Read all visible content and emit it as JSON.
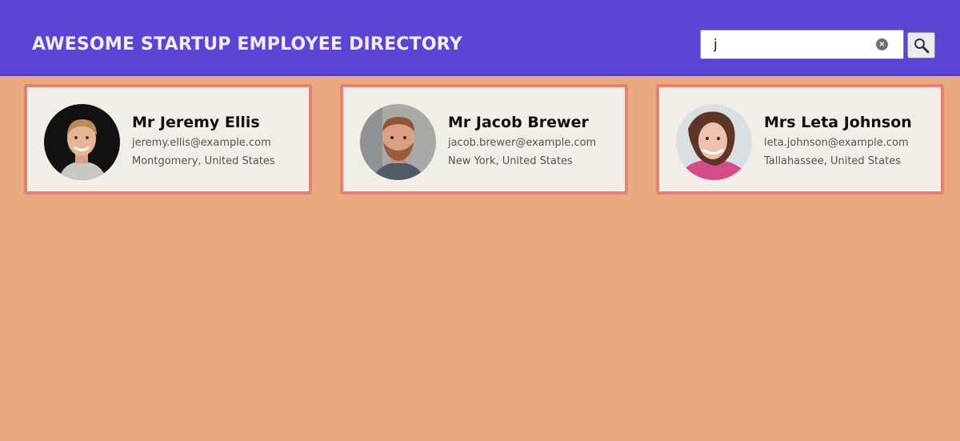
{
  "header": {
    "title": "AWESOME STARTUP EMPLOYEE DIRECTORY"
  },
  "search": {
    "value": "j",
    "clear_icon": "x-circle-icon",
    "button_icon": "magnifier-icon"
  },
  "employees": [
    {
      "name": "Mr Jeremy Ellis",
      "email": "jeremy.ellis@example.com",
      "location": "Montgomery, United States"
    },
    {
      "name": "Mr Jacob Brewer",
      "email": "jacob.brewer@example.com",
      "location": "New York, United States"
    },
    {
      "name": "Mrs Leta Johnson",
      "email": "leta.johnson@example.com",
      "location": "Tallahassee, United States"
    }
  ],
  "colors": {
    "header": "#5c45d2",
    "background": "#e9aa82",
    "card": "#f3ede7",
    "card_border": "#e8806d"
  }
}
